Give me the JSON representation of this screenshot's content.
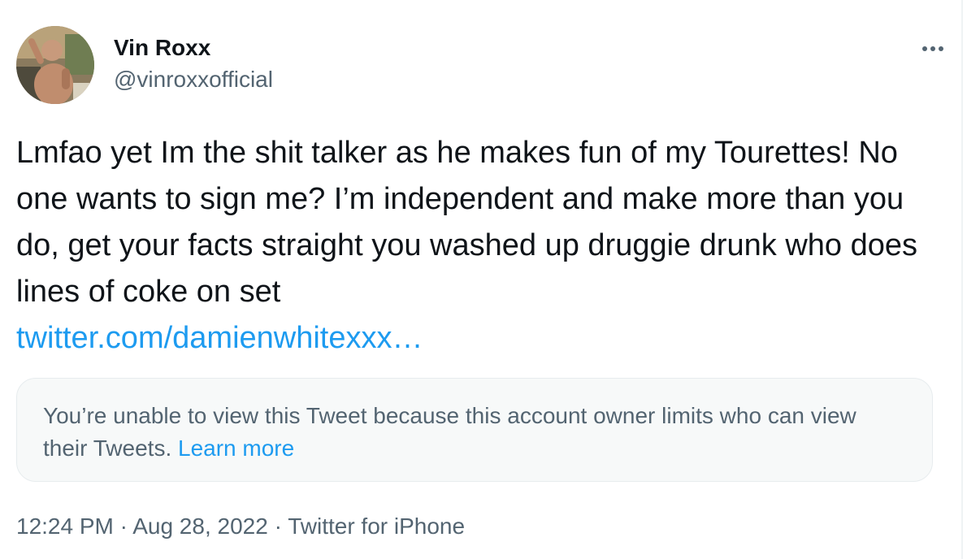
{
  "tweet": {
    "author": {
      "display_name": "Vin Roxx",
      "handle": "@vinroxxofficial"
    },
    "text": "Lmfao yet Im the shit talker as he makes fun of my Tourettes! No one wants to sign me? I’m independent and make more than you do, get your facts straight you washed up druggie drunk who does lines of coke on set",
    "link": "twitter.com/damienwhitexxx…",
    "notice": {
      "message": "You’re unable to view this Tweet because this account owner limits who can view their Tweets.",
      "learn_more": "Learn more"
    },
    "meta": {
      "time": "12:24 PM",
      "separator": "·",
      "date": "Aug 28, 2022",
      "source": "Twitter for iPhone"
    },
    "icons": {
      "more": "more-horizontal-icon"
    },
    "colors": {
      "link": "#1d9bf0",
      "secondary_text": "#536471",
      "primary_text": "#0f1419",
      "notice_bg": "#f7f9f9"
    }
  }
}
